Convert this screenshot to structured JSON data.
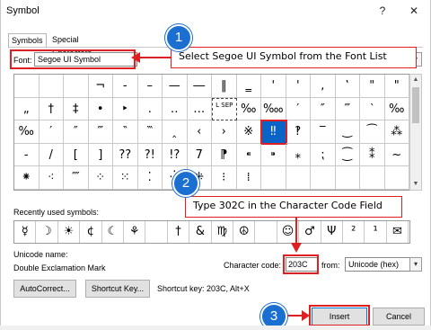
{
  "window": {
    "title": "Symbol",
    "help": "?",
    "close": "✕"
  },
  "tabs": [
    "Symbols",
    "Special Characters"
  ],
  "font": {
    "label": "Font:",
    "value": "Segoe UI Symbol"
  },
  "grid_rows": [
    [
      "",
      "",
      "",
      "¬",
      "-",
      "–",
      "—",
      "―",
      "‖",
      "‗",
      "'",
      "'",
      "‚",
      "‛",
      "\"",
      "\""
    ],
    [
      "„",
      "†",
      "‡",
      "•",
      "‣",
      "․",
      "‥",
      "…",
      "L SEP",
      "‰",
      "‱",
      "′",
      "″",
      "‴",
      "‵",
      "‰"
    ],
    [
      "‰",
      "′",
      "″",
      "‴",
      "‶",
      "‷",
      "‸",
      "‹",
      "›",
      "※",
      "‼",
      "‽",
      "‾",
      "‿",
      "⁀",
      "⁂"
    ],
    [
      "-",
      "/",
      "[",
      "]",
      "??",
      "?!",
      "!?",
      "7",
      "⁋",
      "⁌",
      "⁍",
      "⁎",
      "⁏",
      "⁐",
      "⁑",
      "~"
    ],
    [
      "⁕",
      "⁖",
      "⁗",
      "⁘",
      "⁙",
      "⁚",
      "⁛",
      "⁜",
      "⁝",
      "⁞",
      "",
      "",
      "",
      "",
      "",
      ""
    ]
  ],
  "recent": {
    "label": "Recently used symbols:",
    "items": [
      "☿",
      "☽",
      "☀",
      "¢",
      "☾",
      "⚘",
      "",
      "†",
      "&",
      "♍",
      "☮",
      "",
      "☺",
      "♂",
      "Ψ",
      "²",
      "¹",
      "✉"
    ]
  },
  "unicode_name_label": "Unicode name:",
  "unicode_name": "Double Exclamation Mark",
  "char_code": {
    "label": "Character code:",
    "value": "203C"
  },
  "from": {
    "label": "from:",
    "value": "Unicode (hex)"
  },
  "buttons": {
    "autocorrect": "AutoCorrect...",
    "shortcut_key": "Shortcut Key...",
    "insert": "Insert",
    "cancel": "Cancel"
  },
  "shortcut_text": "Shortcut key: 203C, Alt+X",
  "callouts": {
    "one": {
      "number": "1",
      "text": "Select Segoe UI Symbol from the Font List"
    },
    "two": {
      "number": "2",
      "text": "Type 302C in the Character Code Field"
    },
    "three": {
      "number": "3"
    }
  },
  "colors": {
    "accent": "#1a6fd0",
    "highlight": "#e02020",
    "selected": "#0a64c8"
  }
}
